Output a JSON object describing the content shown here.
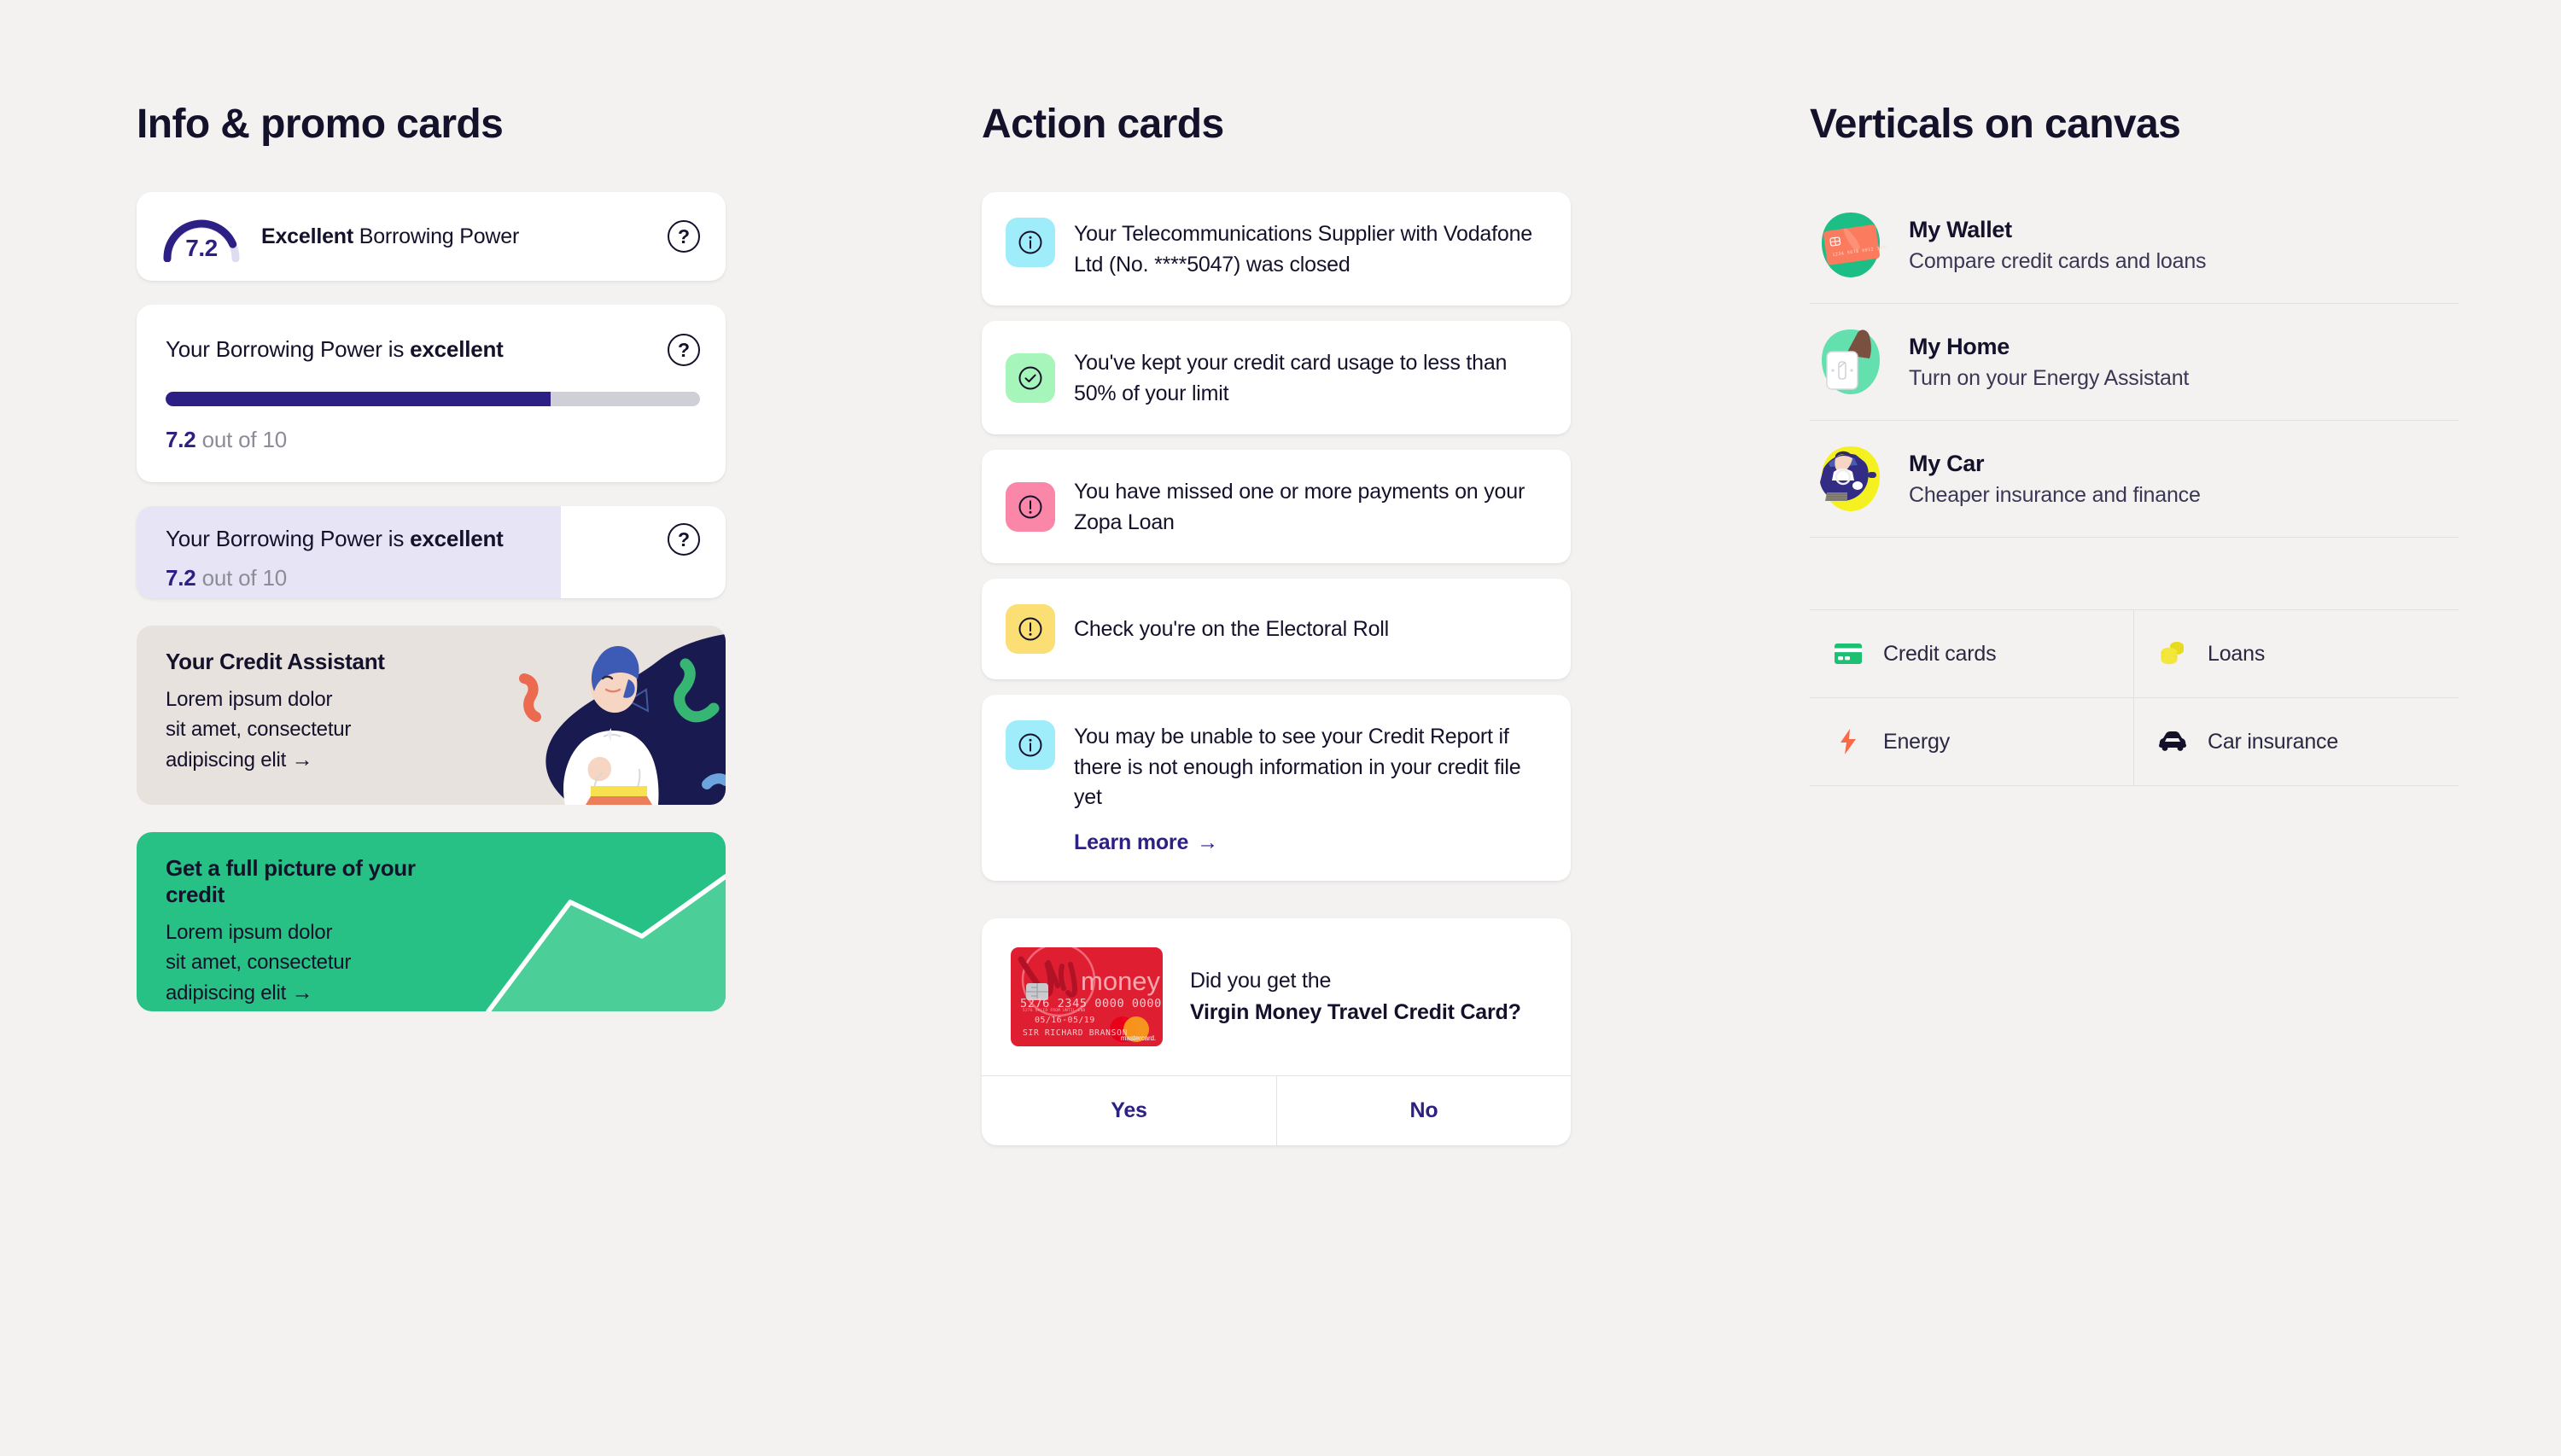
{
  "background_color": "#F4F2F0",
  "accent_indigo": "#2C2084",
  "accent_green": "#27C185",
  "text_dark": "#14112B",
  "columns": {
    "info": {
      "title": "Info & promo cards"
    },
    "action": {
      "title": "Action cards"
    },
    "verticals": {
      "title": "Verticals on canvas"
    }
  },
  "info": {
    "gauge_card": {
      "score": "7.2",
      "score_max": 10,
      "percent": 72,
      "rating": "Excellent",
      "label_rest": " Borrowing Power",
      "help_icon": "question-mark-icon",
      "help_label": "?"
    },
    "progress_card": {
      "title_prefix": "Your Borrowing Power is ",
      "title_strong": "excellent",
      "percent": 72,
      "score": "7.2",
      "score_suffix": " out of 10",
      "help_label": "?"
    },
    "fill_card": {
      "title_prefix": "Your Borrowing Power is ",
      "title_strong": "excellent",
      "percent": 72,
      "score": "7.2",
      "score_suffix": " out of 10",
      "help_label": "?",
      "fill_color": "#E7E5F5"
    },
    "promo_assistant": {
      "title": "Your Credit Assistant",
      "line1": "Lorem ipsum dolor",
      "line2": "sit amet, consectetur",
      "line3": "adipiscing elit",
      "arrow": "→",
      "background": "#E8E2DF",
      "art": "credit-assistant-illustration"
    },
    "promo_credit": {
      "title": "Get a full picture of your credit",
      "line1": "Lorem ipsum dolor",
      "line2": "sit amet, consectetur",
      "line3": "adipiscing elit",
      "arrow": "→",
      "background": "#27C185",
      "art": "line-chart-illustration"
    }
  },
  "action_cards": [
    {
      "icon": "info-circle-icon",
      "icon_bg": "#9FEDFB",
      "text": "Your Telecommunications Supplier with Vodafone Ltd (No. ****5047) was closed"
    },
    {
      "icon": "check-circle-icon",
      "icon_bg": "#A6F5BA",
      "text": "You've kept your credit card usage to less than 50% of your limit"
    },
    {
      "icon": "alert-circle-icon",
      "icon_bg": "#FB87A8",
      "text": "You have missed one or more payments on your Zopa Loan"
    },
    {
      "icon": "alert-circle-icon",
      "icon_bg": "#FBDE74",
      "text": "Check you're on the Electoral Roll"
    },
    {
      "icon": "info-circle-icon",
      "icon_bg": "#9FEDFB",
      "text": "You may be unable to see your Credit Report if there is not enough information in your credit file yet",
      "link_label": "Learn more",
      "link_arrow": "→"
    }
  ],
  "offer_card": {
    "question_line1": "Did you get the",
    "question_strong": "Virgin Money Travel Credit Card",
    "question_suffix": "?",
    "card_art": {
      "brand_virgin": "Virgin",
      "brand_money": "money",
      "number": "5276 2345 0000 0000",
      "micro_labels": "5276            VALID FROM        UNTIL END",
      "dates": "05/16-05/19",
      "holder": "SIR RICHARD BRANSON",
      "network": "mastercard.",
      "background": "#E01E32"
    },
    "yes_label": "Yes",
    "no_label": "No"
  },
  "verticals": [
    {
      "art": "wallet-card-illustration",
      "name": "My Wallet",
      "subtitle": "Compare credit cards and loans"
    },
    {
      "art": "home-lightswitch-illustration",
      "name": "My Home",
      "subtitle": "Turn on your Energy Assistant"
    },
    {
      "art": "car-driver-illustration",
      "name": "My Car",
      "subtitle": "Cheaper insurance and finance"
    }
  ],
  "quick_links": [
    {
      "icon": "credit-card-icon",
      "color": "#1DBF73",
      "label": "Credit cards"
    },
    {
      "icon": "coins-icon",
      "color": "#E8DB1E",
      "label": "Loans"
    },
    {
      "icon": "lightning-bolt-icon",
      "color": "#FB6A45",
      "label": "Energy"
    },
    {
      "icon": "car-icon",
      "color": "#14112B",
      "label": "Car insurance"
    }
  ]
}
